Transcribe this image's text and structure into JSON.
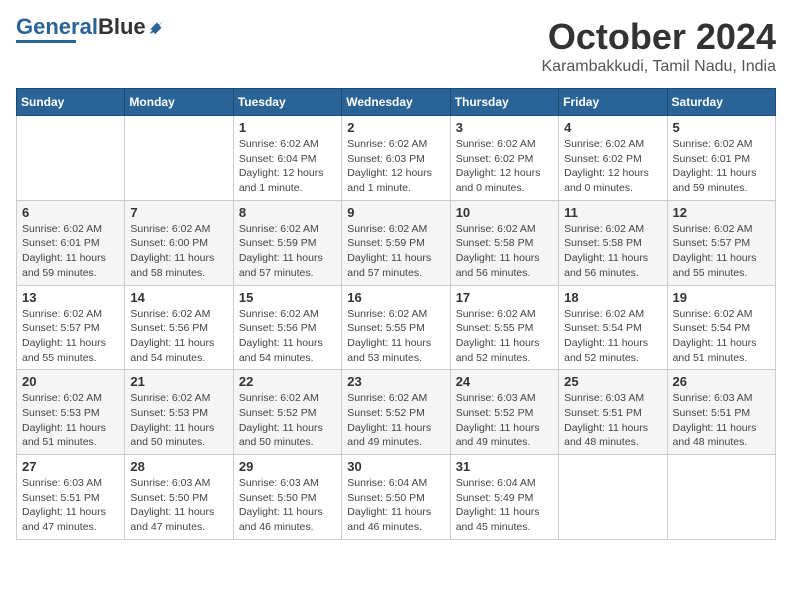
{
  "logo": {
    "part1": "General",
    "part2": "Blue"
  },
  "title": "October 2024",
  "location": "Karambakkudi, Tamil Nadu, India",
  "weekdays": [
    "Sunday",
    "Monday",
    "Tuesday",
    "Wednesday",
    "Thursday",
    "Friday",
    "Saturday"
  ],
  "weeks": [
    [
      {
        "day": "",
        "info": ""
      },
      {
        "day": "",
        "info": ""
      },
      {
        "day": "1",
        "info": "Sunrise: 6:02 AM\nSunset: 6:04 PM\nDaylight: 12 hours and 1 minute."
      },
      {
        "day": "2",
        "info": "Sunrise: 6:02 AM\nSunset: 6:03 PM\nDaylight: 12 hours and 1 minute."
      },
      {
        "day": "3",
        "info": "Sunrise: 6:02 AM\nSunset: 6:02 PM\nDaylight: 12 hours and 0 minutes."
      },
      {
        "day": "4",
        "info": "Sunrise: 6:02 AM\nSunset: 6:02 PM\nDaylight: 12 hours and 0 minutes."
      },
      {
        "day": "5",
        "info": "Sunrise: 6:02 AM\nSunset: 6:01 PM\nDaylight: 11 hours and 59 minutes."
      }
    ],
    [
      {
        "day": "6",
        "info": "Sunrise: 6:02 AM\nSunset: 6:01 PM\nDaylight: 11 hours and 59 minutes."
      },
      {
        "day": "7",
        "info": "Sunrise: 6:02 AM\nSunset: 6:00 PM\nDaylight: 11 hours and 58 minutes."
      },
      {
        "day": "8",
        "info": "Sunrise: 6:02 AM\nSunset: 5:59 PM\nDaylight: 11 hours and 57 minutes."
      },
      {
        "day": "9",
        "info": "Sunrise: 6:02 AM\nSunset: 5:59 PM\nDaylight: 11 hours and 57 minutes."
      },
      {
        "day": "10",
        "info": "Sunrise: 6:02 AM\nSunset: 5:58 PM\nDaylight: 11 hours and 56 minutes."
      },
      {
        "day": "11",
        "info": "Sunrise: 6:02 AM\nSunset: 5:58 PM\nDaylight: 11 hours and 56 minutes."
      },
      {
        "day": "12",
        "info": "Sunrise: 6:02 AM\nSunset: 5:57 PM\nDaylight: 11 hours and 55 minutes."
      }
    ],
    [
      {
        "day": "13",
        "info": "Sunrise: 6:02 AM\nSunset: 5:57 PM\nDaylight: 11 hours and 55 minutes."
      },
      {
        "day": "14",
        "info": "Sunrise: 6:02 AM\nSunset: 5:56 PM\nDaylight: 11 hours and 54 minutes."
      },
      {
        "day": "15",
        "info": "Sunrise: 6:02 AM\nSunset: 5:56 PM\nDaylight: 11 hours and 54 minutes."
      },
      {
        "day": "16",
        "info": "Sunrise: 6:02 AM\nSunset: 5:55 PM\nDaylight: 11 hours and 53 minutes."
      },
      {
        "day": "17",
        "info": "Sunrise: 6:02 AM\nSunset: 5:55 PM\nDaylight: 11 hours and 52 minutes."
      },
      {
        "day": "18",
        "info": "Sunrise: 6:02 AM\nSunset: 5:54 PM\nDaylight: 11 hours and 52 minutes."
      },
      {
        "day": "19",
        "info": "Sunrise: 6:02 AM\nSunset: 5:54 PM\nDaylight: 11 hours and 51 minutes."
      }
    ],
    [
      {
        "day": "20",
        "info": "Sunrise: 6:02 AM\nSunset: 5:53 PM\nDaylight: 11 hours and 51 minutes."
      },
      {
        "day": "21",
        "info": "Sunrise: 6:02 AM\nSunset: 5:53 PM\nDaylight: 11 hours and 50 minutes."
      },
      {
        "day": "22",
        "info": "Sunrise: 6:02 AM\nSunset: 5:52 PM\nDaylight: 11 hours and 50 minutes."
      },
      {
        "day": "23",
        "info": "Sunrise: 6:02 AM\nSunset: 5:52 PM\nDaylight: 11 hours and 49 minutes."
      },
      {
        "day": "24",
        "info": "Sunrise: 6:03 AM\nSunset: 5:52 PM\nDaylight: 11 hours and 49 minutes."
      },
      {
        "day": "25",
        "info": "Sunrise: 6:03 AM\nSunset: 5:51 PM\nDaylight: 11 hours and 48 minutes."
      },
      {
        "day": "26",
        "info": "Sunrise: 6:03 AM\nSunset: 5:51 PM\nDaylight: 11 hours and 48 minutes."
      }
    ],
    [
      {
        "day": "27",
        "info": "Sunrise: 6:03 AM\nSunset: 5:51 PM\nDaylight: 11 hours and 47 minutes."
      },
      {
        "day": "28",
        "info": "Sunrise: 6:03 AM\nSunset: 5:50 PM\nDaylight: 11 hours and 47 minutes."
      },
      {
        "day": "29",
        "info": "Sunrise: 6:03 AM\nSunset: 5:50 PM\nDaylight: 11 hours and 46 minutes."
      },
      {
        "day": "30",
        "info": "Sunrise: 6:04 AM\nSunset: 5:50 PM\nDaylight: 11 hours and 46 minutes."
      },
      {
        "day": "31",
        "info": "Sunrise: 6:04 AM\nSunset: 5:49 PM\nDaylight: 11 hours and 45 minutes."
      },
      {
        "day": "",
        "info": ""
      },
      {
        "day": "",
        "info": ""
      }
    ]
  ]
}
